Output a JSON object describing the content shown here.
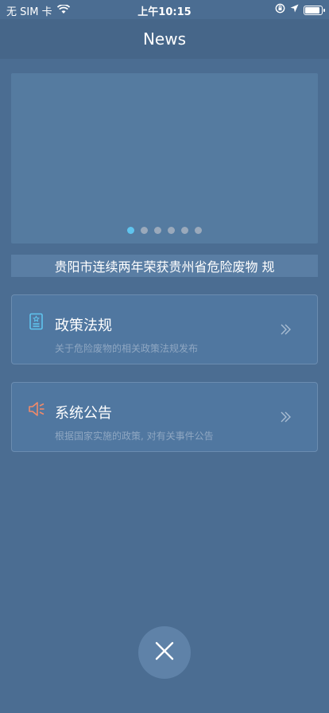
{
  "status_bar": {
    "carrier": "无 SIM 卡",
    "time": "上午10:15",
    "battery_level": 0.95
  },
  "header": {
    "title": "News"
  },
  "carousel": {
    "page_count": 6,
    "active_index": 0
  },
  "ticker": {
    "text": "贵阳市连续两年荣获贵州省危险废物 规"
  },
  "cards": [
    {
      "title": "政策法规",
      "subtitle": "关于危险废物的相关政策法规发布",
      "icon": "document-icon",
      "icon_color": "#5fc4ee"
    },
    {
      "title": "系统公告",
      "subtitle": "根据国家实施的政策, 对有关事件公告",
      "icon": "speaker-icon",
      "icon_color": "#f08a6a"
    }
  ],
  "colors": {
    "background": "#4b6d92",
    "accent": "#5fc4ee"
  }
}
